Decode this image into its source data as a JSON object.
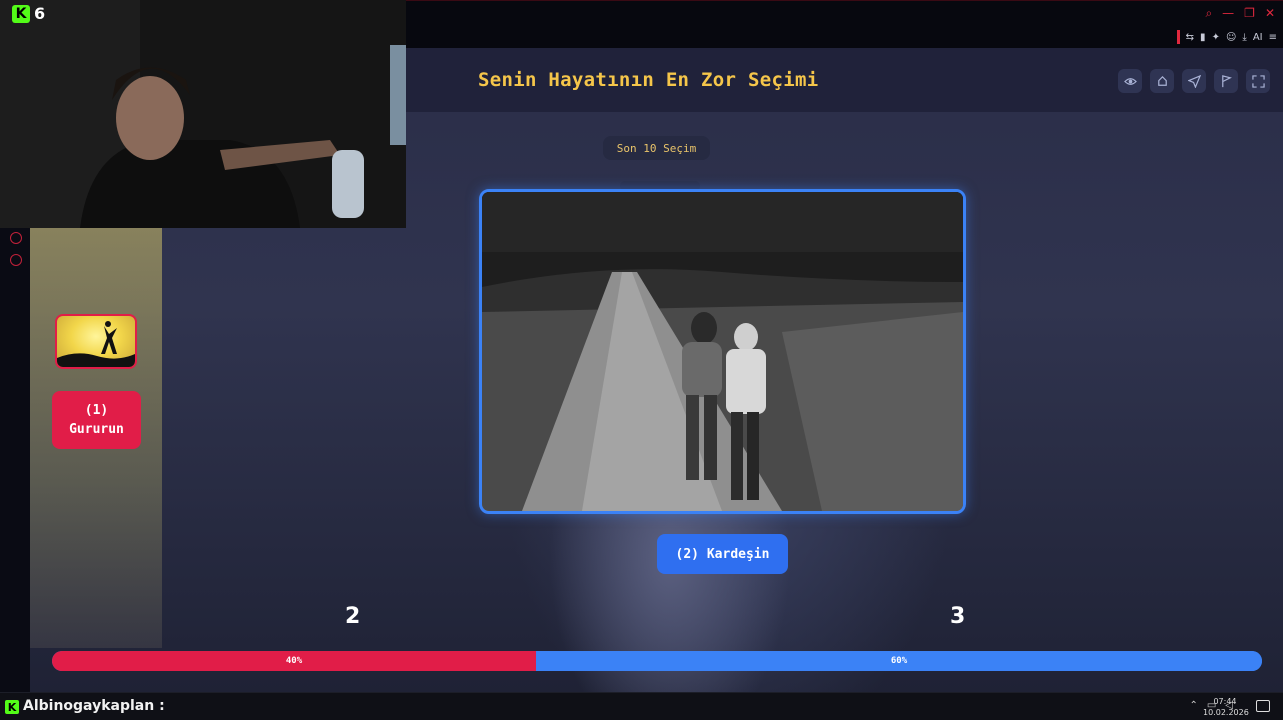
{
  "stream": {
    "viewer_count": "6",
    "kick_icon": "K"
  },
  "window": {
    "controls": [
      "search-icon",
      "minimize-icon",
      "restore-icon",
      "close-icon"
    ]
  },
  "toolbar": {
    "ai_label": "AI"
  },
  "game": {
    "title": "Senin Hayatının En Zor Seçimi",
    "history_button": "Son 10 Seçim",
    "header_actions": [
      "eye-icon",
      "share-icon",
      "send-icon",
      "flag-icon",
      "fullscreen-icon"
    ],
    "option1": {
      "number": "(1)",
      "label": "Gururun"
    },
    "option2": {
      "label": "(2) Kardeşin"
    },
    "votes": {
      "left": "2",
      "right": "3"
    },
    "result": {
      "left_percent": 0.4,
      "right_percent": 0.6,
      "left_label": "40%",
      "right_label": "60%",
      "left_color": "#e11d48",
      "right_color": "#3b82f6"
    },
    "accent": "#f5c64a"
  },
  "taskbar": {
    "username": "Albinogaykaplan :",
    "time": "07:44",
    "date": "10.02.2026"
  }
}
